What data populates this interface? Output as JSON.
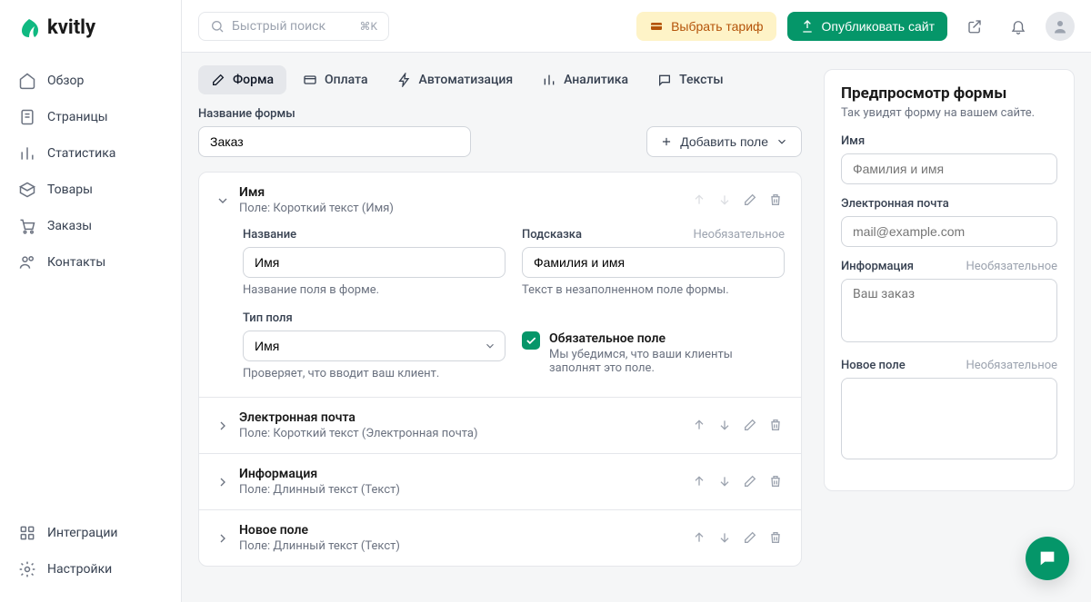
{
  "brand": "kvitly",
  "search": {
    "placeholder": "Быстрый поиск",
    "kbd": "⌘K"
  },
  "topbar": {
    "tariff": "Выбрать тариф",
    "publish": "Опубликовать сайт"
  },
  "sidebar": {
    "items": [
      {
        "label": "Обзор"
      },
      {
        "label": "Страницы"
      },
      {
        "label": "Статистика"
      },
      {
        "label": "Товары"
      },
      {
        "label": "Заказы"
      },
      {
        "label": "Контакты"
      }
    ],
    "bottom": [
      {
        "label": "Интеграции"
      },
      {
        "label": "Настройки"
      }
    ]
  },
  "tabs": [
    {
      "label": "Форма"
    },
    {
      "label": "Оплата"
    },
    {
      "label": "Автоматизация"
    },
    {
      "label": "Аналитика"
    },
    {
      "label": "Тексты"
    }
  ],
  "form": {
    "name_label": "Название формы",
    "name_value": "Заказ",
    "add_field": "Добавить поле"
  },
  "field_editor": {
    "name_label": "Название",
    "name_value": "Имя",
    "name_hint": "Название поля в форме.",
    "hint_label": "Подсказка",
    "hint_optional": "Необязательное",
    "hint_value": "Фамилия и имя",
    "hint_hint": "Текст в незаполненном поле формы.",
    "type_label": "Тип поля",
    "type_value": "Имя",
    "type_hint": "Проверяет, что вводит ваш клиент.",
    "required_title": "Обязательное поле",
    "required_sub": "Мы убедимся, что ваши клиенты заполнят это поле."
  },
  "fields": [
    {
      "title": "Имя",
      "sub": "Поле: Короткий текст (Имя)"
    },
    {
      "title": "Электронная почта",
      "sub": "Поле: Короткий текст (Электронная почта)"
    },
    {
      "title": "Информация",
      "sub": "Поле: Длинный текст (Текст)"
    },
    {
      "title": "Новое поле",
      "sub": "Поле: Длинный текст (Текст)"
    }
  ],
  "preview": {
    "title": "Предпросмотр формы",
    "sub": "Так увидят форму на вашем сайте.",
    "optional": "Необязательное",
    "fields": [
      {
        "label": "Имя",
        "placeholder": "Фамилия и имя",
        "type": "text"
      },
      {
        "label": "Электронная почта",
        "placeholder": "mail@example.com",
        "type": "text"
      },
      {
        "label": "Информация",
        "placeholder": "Ваш заказ",
        "type": "textarea",
        "optional": true
      },
      {
        "label": "Новое поле",
        "placeholder": "",
        "type": "textarea",
        "optional": true
      }
    ]
  }
}
